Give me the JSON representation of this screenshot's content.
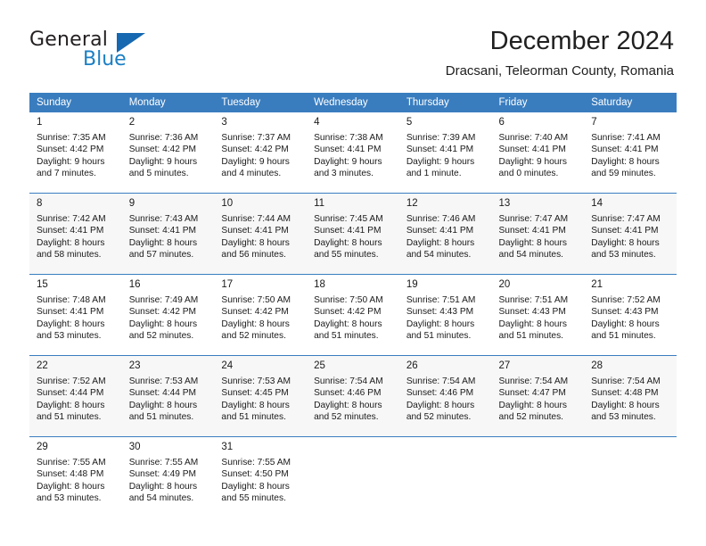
{
  "brand": {
    "name_part1": "General",
    "name_part2": "Blue",
    "triangle_color": "#1668b0",
    "blue_color": "#1b7fc4"
  },
  "header": {
    "title": "December 2024",
    "location": "Dracsani, Teleorman County, Romania"
  },
  "theme": {
    "header_bg": "#3a7dbf",
    "header_text": "#ffffff",
    "alt_row_bg": "#f7f7f7",
    "row_border": "#3a7dbf"
  },
  "weekdays": [
    "Sunday",
    "Monday",
    "Tuesday",
    "Wednesday",
    "Thursday",
    "Friday",
    "Saturday"
  ],
  "weeks": [
    {
      "alt": false,
      "days": [
        {
          "day": "1",
          "sunrise": "Sunrise: 7:35 AM",
          "sunset": "Sunset: 4:42 PM",
          "daylight_1": "Daylight: 9 hours",
          "daylight_2": "and 7 minutes."
        },
        {
          "day": "2",
          "sunrise": "Sunrise: 7:36 AM",
          "sunset": "Sunset: 4:42 PM",
          "daylight_1": "Daylight: 9 hours",
          "daylight_2": "and 5 minutes."
        },
        {
          "day": "3",
          "sunrise": "Sunrise: 7:37 AM",
          "sunset": "Sunset: 4:42 PM",
          "daylight_1": "Daylight: 9 hours",
          "daylight_2": "and 4 minutes."
        },
        {
          "day": "4",
          "sunrise": "Sunrise: 7:38 AM",
          "sunset": "Sunset: 4:41 PM",
          "daylight_1": "Daylight: 9 hours",
          "daylight_2": "and 3 minutes."
        },
        {
          "day": "5",
          "sunrise": "Sunrise: 7:39 AM",
          "sunset": "Sunset: 4:41 PM",
          "daylight_1": "Daylight: 9 hours",
          "daylight_2": "and 1 minute."
        },
        {
          "day": "6",
          "sunrise": "Sunrise: 7:40 AM",
          "sunset": "Sunset: 4:41 PM",
          "daylight_1": "Daylight: 9 hours",
          "daylight_2": "and 0 minutes."
        },
        {
          "day": "7",
          "sunrise": "Sunrise: 7:41 AM",
          "sunset": "Sunset: 4:41 PM",
          "daylight_1": "Daylight: 8 hours",
          "daylight_2": "and 59 minutes."
        }
      ]
    },
    {
      "alt": true,
      "days": [
        {
          "day": "8",
          "sunrise": "Sunrise: 7:42 AM",
          "sunset": "Sunset: 4:41 PM",
          "daylight_1": "Daylight: 8 hours",
          "daylight_2": "and 58 minutes."
        },
        {
          "day": "9",
          "sunrise": "Sunrise: 7:43 AM",
          "sunset": "Sunset: 4:41 PM",
          "daylight_1": "Daylight: 8 hours",
          "daylight_2": "and 57 minutes."
        },
        {
          "day": "10",
          "sunrise": "Sunrise: 7:44 AM",
          "sunset": "Sunset: 4:41 PM",
          "daylight_1": "Daylight: 8 hours",
          "daylight_2": "and 56 minutes."
        },
        {
          "day": "11",
          "sunrise": "Sunrise: 7:45 AM",
          "sunset": "Sunset: 4:41 PM",
          "daylight_1": "Daylight: 8 hours",
          "daylight_2": "and 55 minutes."
        },
        {
          "day": "12",
          "sunrise": "Sunrise: 7:46 AM",
          "sunset": "Sunset: 4:41 PM",
          "daylight_1": "Daylight: 8 hours",
          "daylight_2": "and 54 minutes."
        },
        {
          "day": "13",
          "sunrise": "Sunrise: 7:47 AM",
          "sunset": "Sunset: 4:41 PM",
          "daylight_1": "Daylight: 8 hours",
          "daylight_2": "and 54 minutes."
        },
        {
          "day": "14",
          "sunrise": "Sunrise: 7:47 AM",
          "sunset": "Sunset: 4:41 PM",
          "daylight_1": "Daylight: 8 hours",
          "daylight_2": "and 53 minutes."
        }
      ]
    },
    {
      "alt": false,
      "days": [
        {
          "day": "15",
          "sunrise": "Sunrise: 7:48 AM",
          "sunset": "Sunset: 4:41 PM",
          "daylight_1": "Daylight: 8 hours",
          "daylight_2": "and 53 minutes."
        },
        {
          "day": "16",
          "sunrise": "Sunrise: 7:49 AM",
          "sunset": "Sunset: 4:42 PM",
          "daylight_1": "Daylight: 8 hours",
          "daylight_2": "and 52 minutes."
        },
        {
          "day": "17",
          "sunrise": "Sunrise: 7:50 AM",
          "sunset": "Sunset: 4:42 PM",
          "daylight_1": "Daylight: 8 hours",
          "daylight_2": "and 52 minutes."
        },
        {
          "day": "18",
          "sunrise": "Sunrise: 7:50 AM",
          "sunset": "Sunset: 4:42 PM",
          "daylight_1": "Daylight: 8 hours",
          "daylight_2": "and 51 minutes."
        },
        {
          "day": "19",
          "sunrise": "Sunrise: 7:51 AM",
          "sunset": "Sunset: 4:43 PM",
          "daylight_1": "Daylight: 8 hours",
          "daylight_2": "and 51 minutes."
        },
        {
          "day": "20",
          "sunrise": "Sunrise: 7:51 AM",
          "sunset": "Sunset: 4:43 PM",
          "daylight_1": "Daylight: 8 hours",
          "daylight_2": "and 51 minutes."
        },
        {
          "day": "21",
          "sunrise": "Sunrise: 7:52 AM",
          "sunset": "Sunset: 4:43 PM",
          "daylight_1": "Daylight: 8 hours",
          "daylight_2": "and 51 minutes."
        }
      ]
    },
    {
      "alt": true,
      "days": [
        {
          "day": "22",
          "sunrise": "Sunrise: 7:52 AM",
          "sunset": "Sunset: 4:44 PM",
          "daylight_1": "Daylight: 8 hours",
          "daylight_2": "and 51 minutes."
        },
        {
          "day": "23",
          "sunrise": "Sunrise: 7:53 AM",
          "sunset": "Sunset: 4:44 PM",
          "daylight_1": "Daylight: 8 hours",
          "daylight_2": "and 51 minutes."
        },
        {
          "day": "24",
          "sunrise": "Sunrise: 7:53 AM",
          "sunset": "Sunset: 4:45 PM",
          "daylight_1": "Daylight: 8 hours",
          "daylight_2": "and 51 minutes."
        },
        {
          "day": "25",
          "sunrise": "Sunrise: 7:54 AM",
          "sunset": "Sunset: 4:46 PM",
          "daylight_1": "Daylight: 8 hours",
          "daylight_2": "and 52 minutes."
        },
        {
          "day": "26",
          "sunrise": "Sunrise: 7:54 AM",
          "sunset": "Sunset: 4:46 PM",
          "daylight_1": "Daylight: 8 hours",
          "daylight_2": "and 52 minutes."
        },
        {
          "day": "27",
          "sunrise": "Sunrise: 7:54 AM",
          "sunset": "Sunset: 4:47 PM",
          "daylight_1": "Daylight: 8 hours",
          "daylight_2": "and 52 minutes."
        },
        {
          "day": "28",
          "sunrise": "Sunrise: 7:54 AM",
          "sunset": "Sunset: 4:48 PM",
          "daylight_1": "Daylight: 8 hours",
          "daylight_2": "and 53 minutes."
        }
      ]
    },
    {
      "alt": false,
      "days": [
        {
          "day": "29",
          "sunrise": "Sunrise: 7:55 AM",
          "sunset": "Sunset: 4:48 PM",
          "daylight_1": "Daylight: 8 hours",
          "daylight_2": "and 53 minutes."
        },
        {
          "day": "30",
          "sunrise": "Sunrise: 7:55 AM",
          "sunset": "Sunset: 4:49 PM",
          "daylight_1": "Daylight: 8 hours",
          "daylight_2": "and 54 minutes."
        },
        {
          "day": "31",
          "sunrise": "Sunrise: 7:55 AM",
          "sunset": "Sunset: 4:50 PM",
          "daylight_1": "Daylight: 8 hours",
          "daylight_2": "and 55 minutes."
        },
        {
          "day": "",
          "sunrise": "",
          "sunset": "",
          "daylight_1": "",
          "daylight_2": ""
        },
        {
          "day": "",
          "sunrise": "",
          "sunset": "",
          "daylight_1": "",
          "daylight_2": ""
        },
        {
          "day": "",
          "sunrise": "",
          "sunset": "",
          "daylight_1": "",
          "daylight_2": ""
        },
        {
          "day": "",
          "sunrise": "",
          "sunset": "",
          "daylight_1": "",
          "daylight_2": ""
        }
      ]
    }
  ]
}
